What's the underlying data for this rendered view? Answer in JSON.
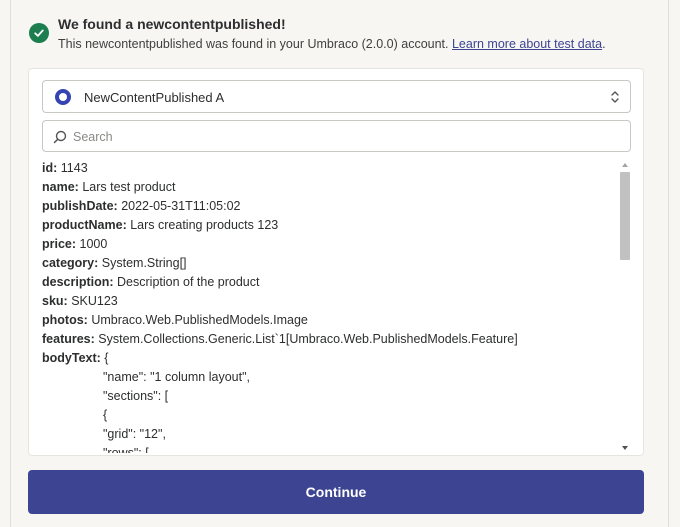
{
  "header": {
    "title": "We found a newcontentpublished!",
    "description": "This newcontentpublished was found in your Umbraco (2.0.0) account.",
    "learn_more_link": "Learn more about test data"
  },
  "record_select": {
    "selected": "NewContentPublished A"
  },
  "search": {
    "placeholder": "Search",
    "value": ""
  },
  "fields": [
    {
      "key": "id:",
      "value": "1143"
    },
    {
      "key": "name:",
      "value": "Lars test product"
    },
    {
      "key": "publishDate:",
      "value": "2022-05-31T11:05:02"
    },
    {
      "key": "productName:",
      "value": "Lars creating products 123"
    },
    {
      "key": "price:",
      "value": "1000"
    },
    {
      "key": "category:",
      "value": "System.String[]"
    },
    {
      "key": "description:",
      "value": "Description of the product"
    },
    {
      "key": "sku:",
      "value": "SKU123"
    },
    {
      "key": "photos:",
      "value": "Umbraco.Web.PublishedModels.Image"
    },
    {
      "key": "features:",
      "value": "System.Collections.Generic.List`1[Umbraco.Web.PublishedModels.Feature]"
    },
    {
      "key": "bodyText:",
      "value": "{"
    }
  ],
  "body_text_lines": [
    "\"name\": \"1 column layout\",",
    "\"sections\": [",
    "{",
    "\"grid\": \"12\",",
    "\"rows\": ["
  ],
  "continue_label": "Continue",
  "colors": {
    "primary": "#3d4592",
    "success": "#1c7d4e",
    "background": "#f7f6f3"
  }
}
